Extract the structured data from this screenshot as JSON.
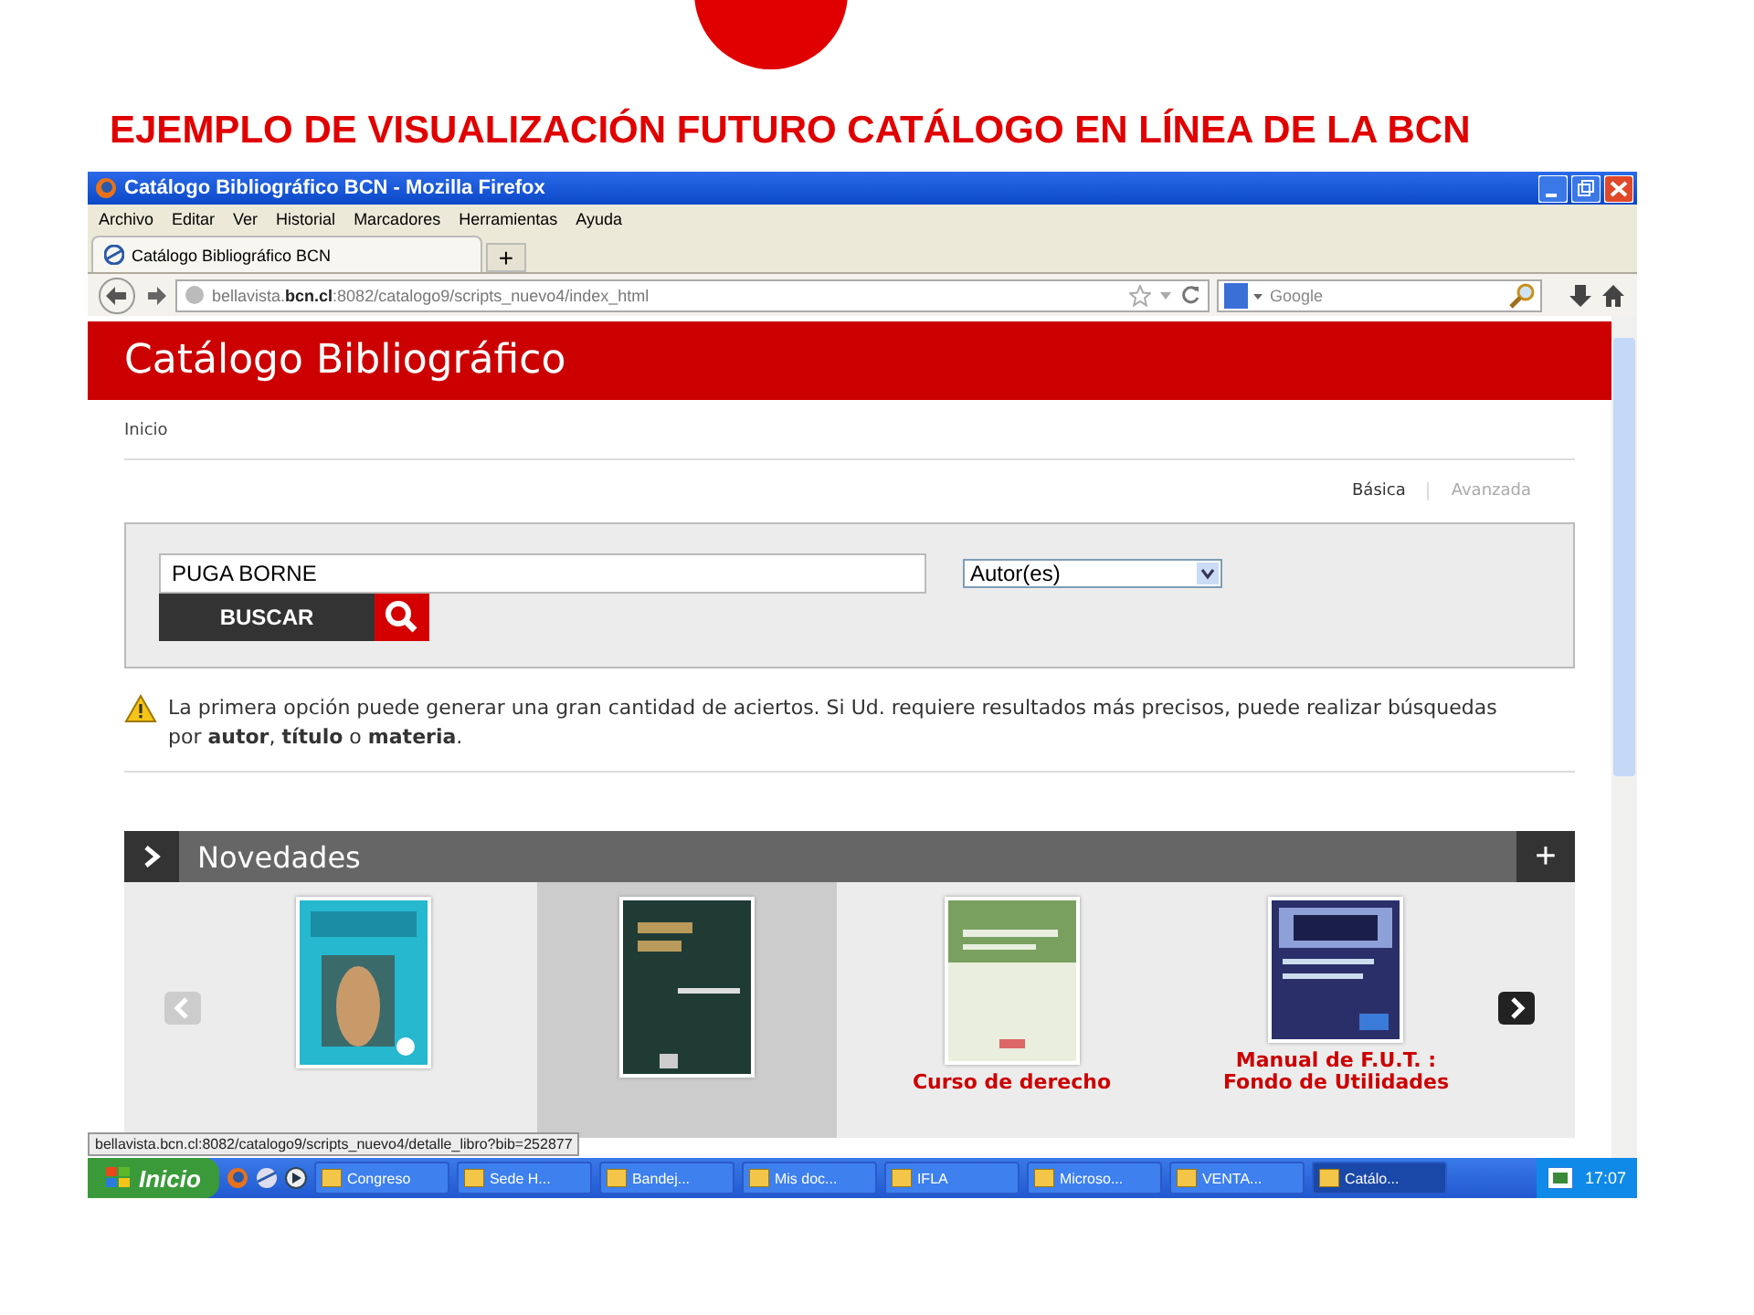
{
  "slide_title": "EJEMPLO DE VISUALIZACIÓN FUTURO CATÁLOGO EN LÍNEA DE LA BCN",
  "window": {
    "title": "Catálogo Bibliográfico BCN - Mozilla Firefox"
  },
  "menu": [
    "Archivo",
    "Editar",
    "Ver",
    "Historial",
    "Marcadores",
    "Herramientas",
    "Ayuda"
  ],
  "tabs": [
    {
      "label": "Catálogo Bibliográfico BCN",
      "selected": true
    }
  ],
  "new_tab": "+",
  "address": "bellavista.**bcn.cl**:8082/catalogo9/scripts_nuevo4/index_html",
  "web_search": {
    "placeholder": "Google"
  },
  "page": {
    "header": "Catálogo Bibliográfico",
    "breadcrumb": "Inicio",
    "search_modes": [
      {
        "label": "Básica",
        "selected": true
      },
      {
        "label": "Avanzada",
        "selected": false
      }
    ],
    "query": "PUGA BORNE",
    "field_select": "Autor(es)",
    "search_button": "BUSCAR",
    "notice": "La primera opción puede generar una gran cantidad de aciertos. Si Ud. requiere resultados más precisos, puede realizar búsquedas por **autor**, **título** o **materia**.",
    "section_title": "Novedades",
    "expand_button": "+",
    "books": [
      {
        "selected": false
      },
      {
        "selected": true
      },
      {
        "title": "Curso de derecho",
        "selected": false
      },
      {
        "title": "Manual de F.U.T. : Fondo de Utilidades",
        "selected": false
      }
    ]
  },
  "status_url": "bellavista.bcn.cl:8082/catalogo9/scripts_nuevo4/detalle_libro?bib=252877",
  "taskbar": {
    "start": "Inicio",
    "items": [
      {
        "label": "Congreso",
        "selected": false
      },
      {
        "label": "Sede H...",
        "selected": false
      },
      {
        "label": "Bandej...",
        "selected": false
      },
      {
        "label": "Mis doc...",
        "selected": false
      },
      {
        "label": "IFLA",
        "selected": false
      },
      {
        "label": "Microso...",
        "selected": false
      },
      {
        "label": "VENTA...",
        "selected": false
      },
      {
        "label": "Catálo...",
        "selected": true
      }
    ],
    "clock": "17:07"
  }
}
